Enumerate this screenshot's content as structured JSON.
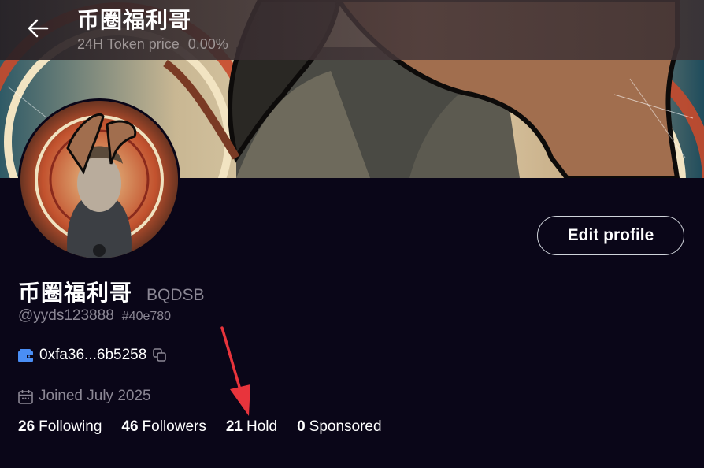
{
  "header": {
    "title": "币圈福利哥",
    "token_price_label": "24H Token price",
    "token_price_change": "0.00%",
    "back_icon": "arrow-left-icon"
  },
  "profile": {
    "display_name": "币圈福利哥",
    "ticker": "BQDSB",
    "handle": "@yyds123888",
    "user_id": "#40e780",
    "wallet_address": "0xfa36...6b5258",
    "joined": "Joined July 2025",
    "edit_button_label": "Edit profile"
  },
  "stats": [
    {
      "value": "26",
      "label": "Following"
    },
    {
      "value": "46",
      "label": "Followers"
    },
    {
      "value": "21",
      "label": "Hold"
    },
    {
      "value": "0",
      "label": "Sponsored"
    }
  ],
  "colors": {
    "background": "#0a0618",
    "muted_text": "#8b8794",
    "wallet_icon": "#4a8ef5",
    "annotation_arrow": "#e8343c"
  },
  "icons": {
    "wallet": "wallet-icon",
    "copy": "copy-icon",
    "calendar": "calendar-icon"
  }
}
